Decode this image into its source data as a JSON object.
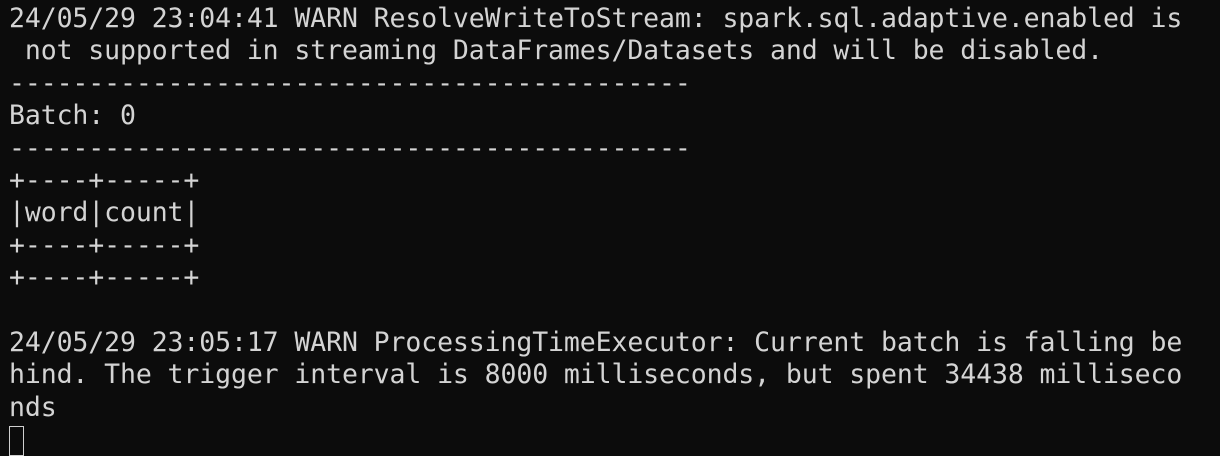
{
  "terminal": {
    "lines": [
      "24/05/29 23:04:41 WARN ResolveWriteToStream: spark.sql.adaptive.enabled is",
      " not supported in streaming DataFrames/Datasets and will be disabled.",
      "-------------------------------------------",
      "Batch: 0",
      "-------------------------------------------",
      "+----+-----+",
      "|word|count|",
      "+----+-----+",
      "+----+-----+",
      "",
      "24/05/29 23:05:17 WARN ProcessingTimeExecutor: Current batch is falling be",
      "hind. The trigger interval is 8000 milliseconds, but spent 34438 milliseco",
      "nds"
    ],
    "cursor": ""
  }
}
